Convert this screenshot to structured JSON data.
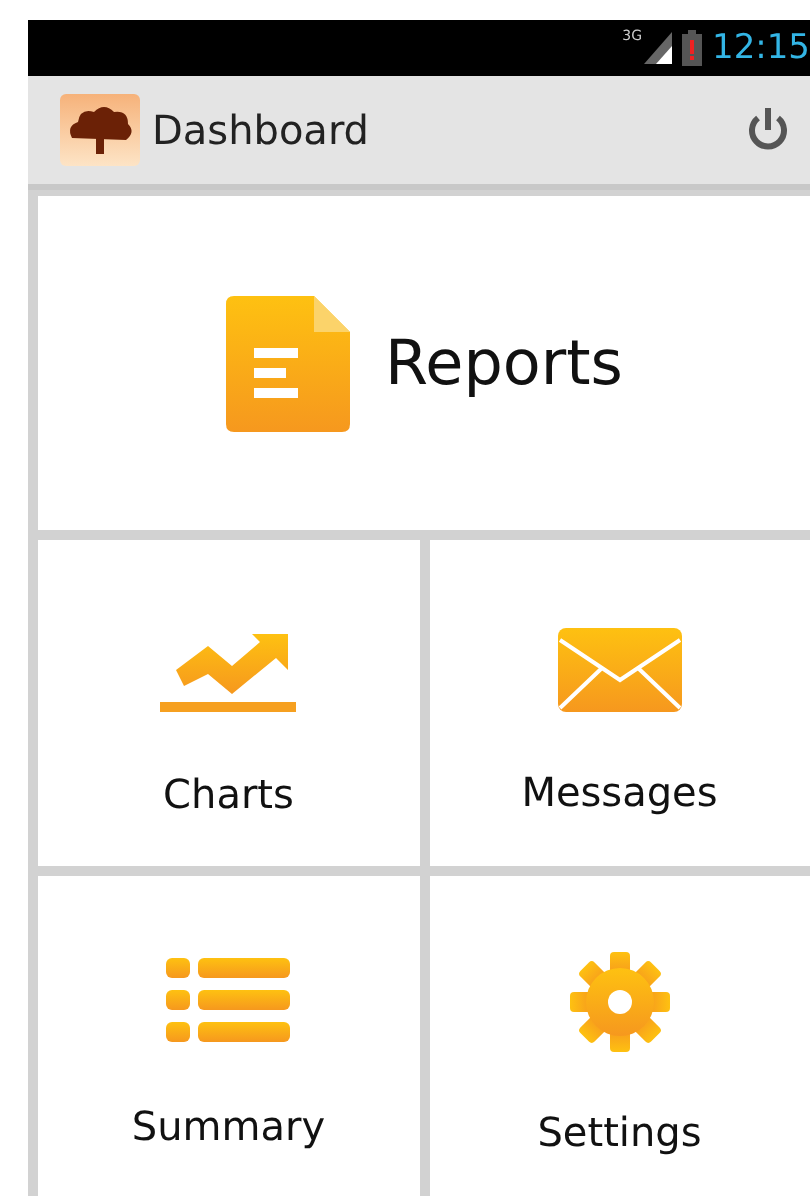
{
  "status_bar": {
    "network": "3G",
    "time": "12:15"
  },
  "action_bar": {
    "title": "Dashboard"
  },
  "tiles": [
    {
      "kind": "reports",
      "label": "Reports"
    },
    {
      "kind": "charts",
      "label": "Charts"
    },
    {
      "kind": "messages",
      "label": "Messages"
    },
    {
      "kind": "summary",
      "label": "Summary"
    },
    {
      "kind": "settings",
      "label": "Settings"
    }
  ]
}
